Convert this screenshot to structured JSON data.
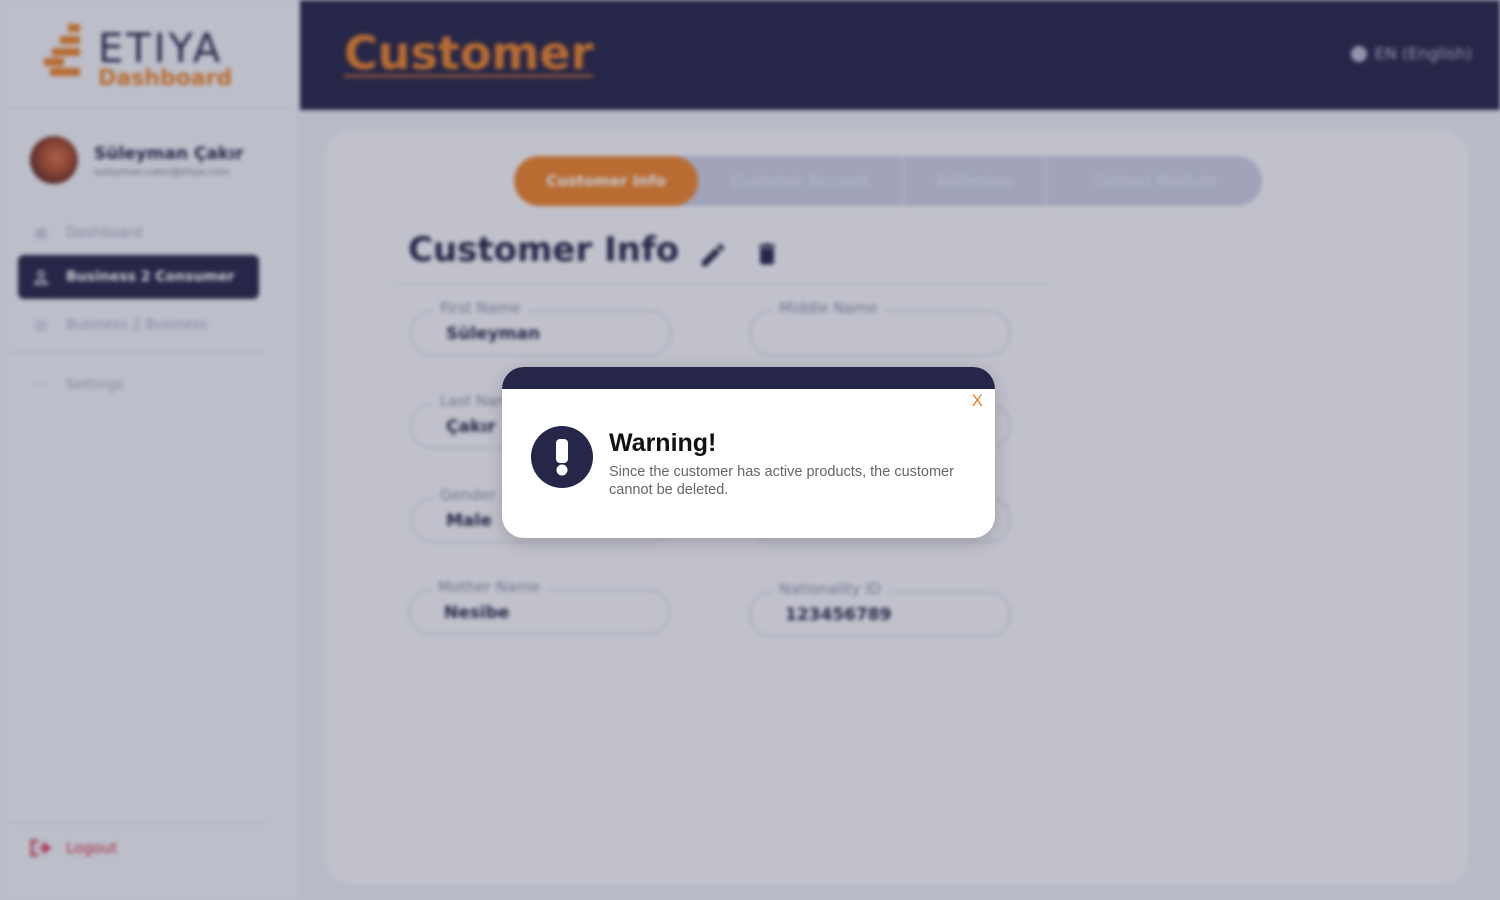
{
  "app": {
    "brand_primary": "ETIYA",
    "brand_secondary": "Dashboard",
    "colors": {
      "navy": "#262648",
      "accent": "#e8832a",
      "danger": "#d22a3f"
    }
  },
  "header": {
    "title": "Customer",
    "language": "EN (English)",
    "language_icon": "globe-icon"
  },
  "sidebar": {
    "user": {
      "name": "Süleyman Çakır",
      "email": "suleyman.cakir@etiya.com"
    },
    "items": [
      {
        "label": "Dashboard",
        "icon": "grid-icon",
        "active": false
      },
      {
        "label": "Business 2 Consumer",
        "icon": "user-icon",
        "active": true
      },
      {
        "label": "Business 2 Business",
        "icon": "calendar-icon",
        "active": false
      },
      {
        "label": "Settings",
        "icon": "dots-icon",
        "active": false
      }
    ],
    "logout": "Logout"
  },
  "tabs": [
    {
      "label": "Customer Info",
      "active": true
    },
    {
      "label": "Customer Account",
      "active": false
    },
    {
      "label": "Addresses",
      "active": false
    },
    {
      "label": "Contact Medium",
      "active": false
    }
  ],
  "section": {
    "title": "Customer Info"
  },
  "fields": {
    "first_name": {
      "label": "First Name",
      "value": "Süleyman"
    },
    "middle_name": {
      "label": "Middle Name",
      "value": ""
    },
    "last_name": {
      "label": "Last Name",
      "value": "Çakır"
    },
    "gender": {
      "label": "Gender",
      "value": "Male"
    },
    "mother_name": {
      "label": "Mother Name",
      "value": "Nesibe"
    },
    "nationality_id": {
      "label": "Nationality ID",
      "value": "123456789"
    }
  },
  "modal": {
    "close_label": "X",
    "title": "Warning!",
    "message": "Since the customer has active products, the customer cannot be deleted.",
    "icon": "exclamation-icon"
  }
}
